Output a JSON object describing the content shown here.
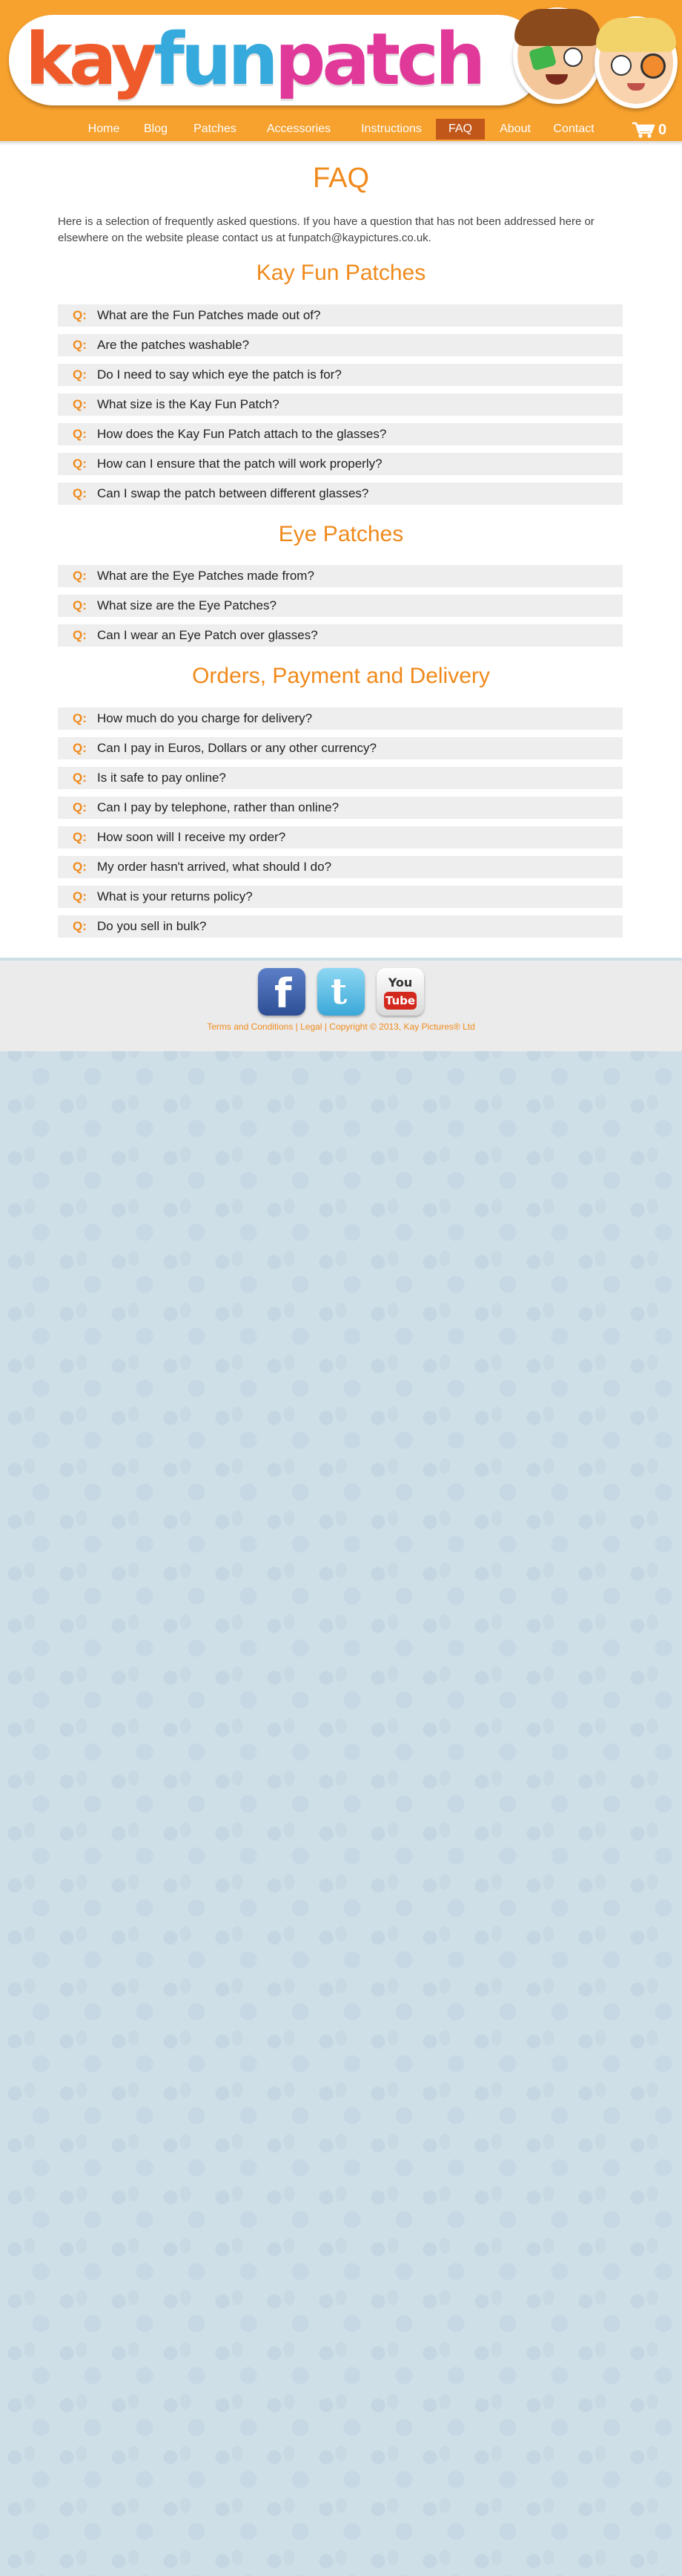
{
  "header": {
    "logo": {
      "part1": "kay",
      "part2": "fun",
      "part3": "patch"
    },
    "nav": [
      {
        "label": "Home"
      },
      {
        "label": "Blog"
      },
      {
        "label": "Patches"
      },
      {
        "label": "Accessories"
      },
      {
        "label": "Instructions"
      },
      {
        "label": "FAQ",
        "active": true
      },
      {
        "label": "About"
      },
      {
        "label": "Contact"
      }
    ],
    "cart_icon": "shopping-cart-icon",
    "cart_count": "0"
  },
  "main": {
    "title": "FAQ",
    "intro": "Here is a selection of frequently asked questions. If you have a question that has not been addressed here or elsewhere on the website please contact us at funpatch@kaypictures.co.uk.",
    "q_prefix": "Q:",
    "sections": [
      {
        "heading": "Kay Fun Patches",
        "questions": [
          "What are the Fun Patches made out of?",
          "Are the patches washable?",
          "Do I need to say which eye the patch is for?",
          "What size is the Kay Fun Patch?",
          "How does the Kay Fun Patch attach to the glasses?",
          "How can I ensure that the patch will work properly?",
          "Can I swap the patch between different glasses?"
        ]
      },
      {
        "heading": "Eye Patches",
        "questions": [
          "What are the Eye Patches made from?",
          "What size are the Eye Patches?",
          "Can I wear an Eye Patch over glasses?"
        ]
      },
      {
        "heading": "Orders, Payment and Delivery",
        "questions": [
          "How much do you charge for delivery?",
          "Can I pay in Euros, Dollars or any other currency?",
          "Is it safe to pay online?",
          "Can I pay by telephone, rather than online?",
          "How soon will I receive my order?",
          "My order hasn't arrived, what should I do?",
          "What is your returns policy?",
          "Do you sell in bulk?"
        ]
      }
    ]
  },
  "footer": {
    "social": [
      {
        "icon": "facebook-icon",
        "glyph": "f"
      },
      {
        "icon": "twitter-icon",
        "glyph": "t"
      },
      {
        "icon": "youtube-icon",
        "glyph_top": "You",
        "glyph_bottom": "Tube"
      }
    ],
    "terms": "Terms and Conditions",
    "legal": "Legal",
    "copyright": "Copyright © 2013, Kay Pictures® Ltd",
    "separator": "|"
  },
  "colors": {
    "brand_orange": "#f7a12e",
    "heading_orange": "#f08a1c",
    "nav_active": "#c2571a",
    "logo_kay": "#ef5a2b",
    "logo_fun": "#36a9dd",
    "logo_patch": "#e0399a"
  }
}
